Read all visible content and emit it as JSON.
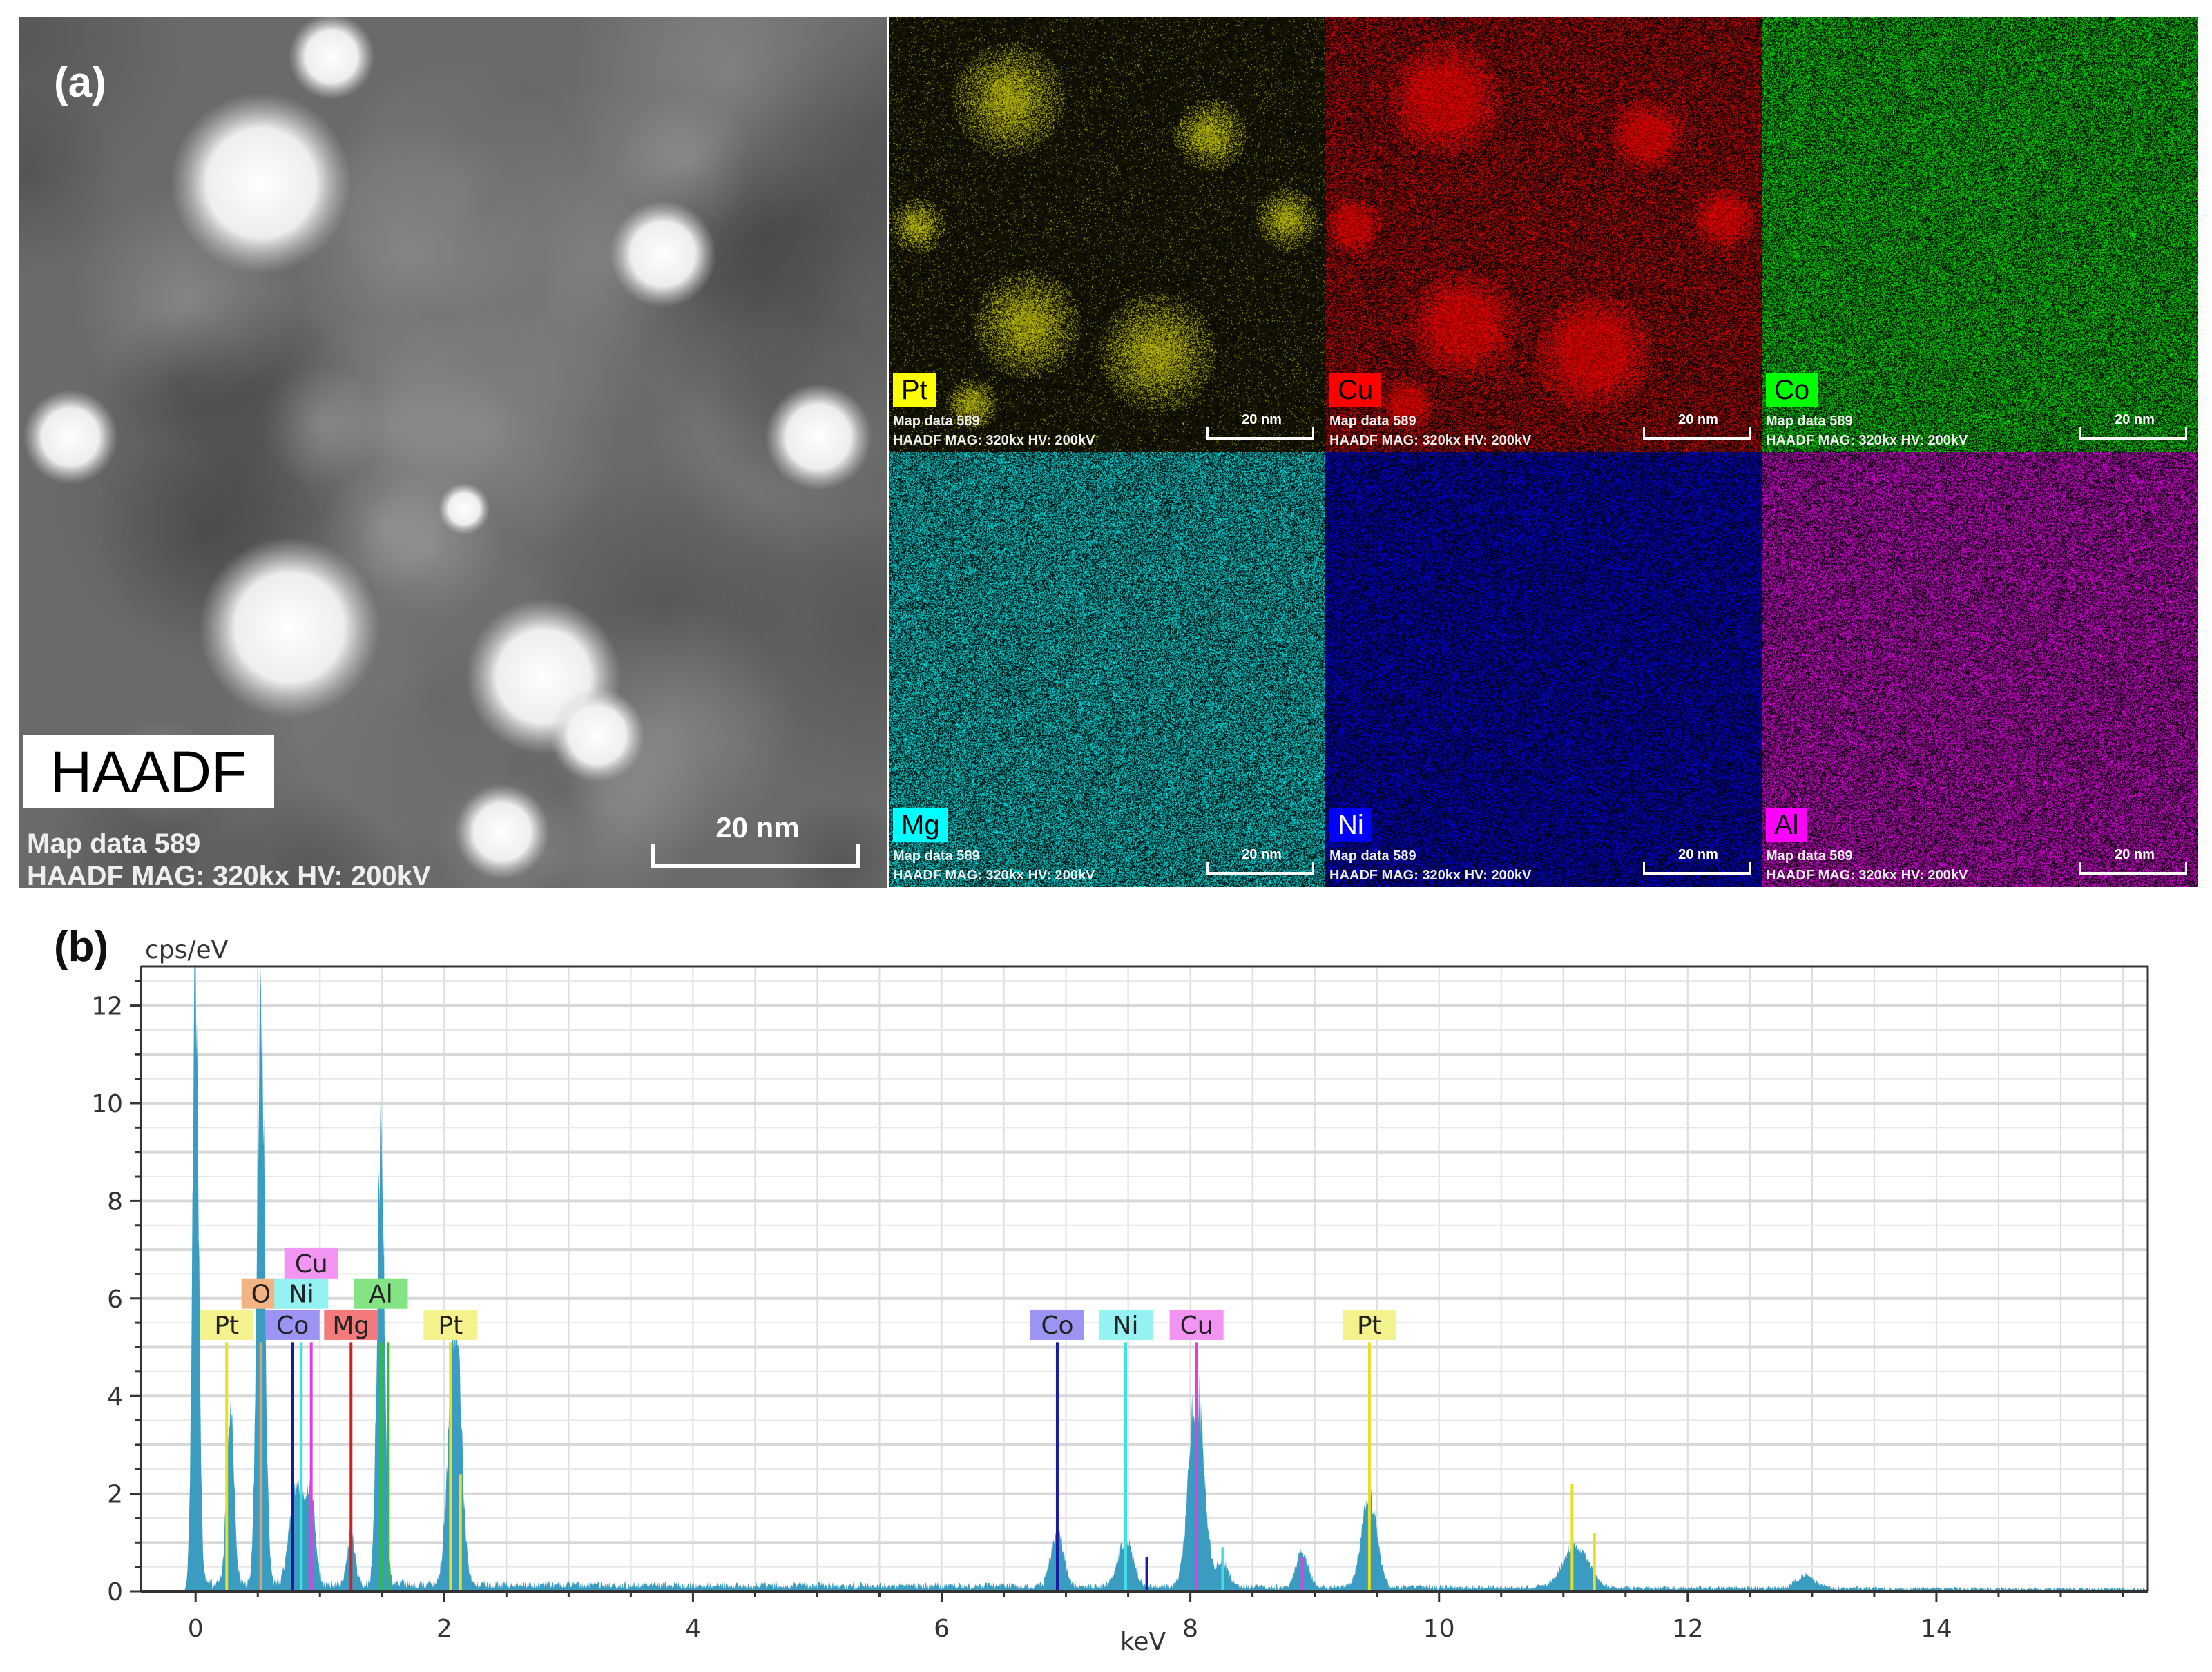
{
  "panel_a": {
    "letter": "(a)",
    "haadf": {
      "title": "HAADF",
      "map_label": "Map data 589",
      "info": "HAADF MAG: 320kx HV: 200kV",
      "scale": "20 nm"
    },
    "maps": [
      {
        "element": "Pt",
        "color": "#ffff00",
        "text_color": "#000000",
        "map_label": "Map data 589",
        "info": "HAADF MAG: 320kx HV: 200kV",
        "scale": "20 nm"
      },
      {
        "element": "Cu",
        "color": "#ff0000",
        "text_color": "#000000",
        "map_label": "Map data 589",
        "info": "HAADF MAG: 320kx HV: 200kV",
        "scale": "20 nm"
      },
      {
        "element": "Co",
        "color": "#00ff00",
        "text_color": "#000000",
        "map_label": "Map data 589",
        "info": "HAADF MAG: 320kx HV: 200kV",
        "scale": "20 nm"
      },
      {
        "element": "Mg",
        "color": "#00ffff",
        "text_color": "#000000",
        "map_label": "Map data 589",
        "info": "HAADF MAG: 320kx HV: 200kV",
        "scale": "20 nm"
      },
      {
        "element": "Ni",
        "color": "#0000ff",
        "text_color": "#ffffff",
        "map_label": "Map data 589",
        "info": "HAADF MAG: 320kx HV: 200kV",
        "scale": "20 nm"
      },
      {
        "element": "Al",
        "color": "#ff00ff",
        "text_color": "#000000",
        "map_label": "Map data 589",
        "info": "HAADF MAG: 320kx HV: 200kV",
        "scale": "20 nm"
      }
    ]
  },
  "panel_b": {
    "letter": "(b)"
  },
  "chart_data": {
    "type": "area",
    "title": "",
    "xlabel": "keV",
    "ylabel": "cps/eV",
    "xlim": [
      -0.44,
      15.7
    ],
    "ylim": [
      0,
      12.8
    ],
    "xticks": [
      0,
      2,
      4,
      6,
      8,
      10,
      12,
      14
    ],
    "yticks": [
      0,
      2,
      4,
      6,
      8,
      10,
      12
    ],
    "grid": true,
    "series_color": "#3a9cc0",
    "background": 0.15,
    "peaks": [
      {
        "energy": 0.0,
        "height": 12.8,
        "width": 0.025
      },
      {
        "energy": 0.28,
        "height": 3.5,
        "width": 0.03
      },
      {
        "energy": 0.525,
        "height": 12.4,
        "width": 0.03
      },
      {
        "energy": 0.78,
        "height": 1.4,
        "width": 0.04
      },
      {
        "energy": 0.85,
        "height": 1.5,
        "width": 0.04
      },
      {
        "energy": 0.93,
        "height": 1.7,
        "width": 0.035
      },
      {
        "energy": 1.25,
        "height": 1.0,
        "width": 0.03
      },
      {
        "energy": 1.49,
        "height": 9.5,
        "width": 0.03
      },
      {
        "energy": 2.07,
        "height": 4.2,
        "width": 0.045
      },
      {
        "energy": 2.12,
        "height": 2.0,
        "width": 0.04
      },
      {
        "energy": 6.93,
        "height": 1.1,
        "width": 0.05
      },
      {
        "energy": 7.48,
        "height": 0.95,
        "width": 0.06
      },
      {
        "energy": 8.05,
        "height": 4.1,
        "width": 0.06
      },
      {
        "energy": 8.26,
        "height": 0.5,
        "width": 0.05
      },
      {
        "energy": 8.9,
        "height": 0.7,
        "width": 0.05
      },
      {
        "energy": 9.44,
        "height": 1.9,
        "width": 0.06
      },
      {
        "energy": 11.1,
        "height": 0.9,
        "width": 0.1
      },
      {
        "energy": 12.95,
        "height": 0.25,
        "width": 0.08
      }
    ],
    "element_markers": [
      {
        "element": "Pt",
        "energy": 0.25,
        "line_color": "#e6e020",
        "label_color": "#f4f28c",
        "row": 0,
        "label": "Pt"
      },
      {
        "element": "O",
        "energy": 0.525,
        "line_color": "#e0a060",
        "label_color": "#f2b482",
        "row": 1,
        "label": "O"
      },
      {
        "element": "Co",
        "energy": 0.78,
        "line_color": "#1a1aa0",
        "label_color": "#9c94f2",
        "row": 0,
        "label": "Co"
      },
      {
        "element": "Ni",
        "energy": 0.85,
        "line_color": "#40e0e0",
        "label_color": "#94f2f2",
        "row": 1,
        "label": "Ni"
      },
      {
        "element": "Cu",
        "energy": 0.93,
        "line_color": "#e040e0",
        "label_color": "#f294f2",
        "row": 2,
        "label": "Cu"
      },
      {
        "element": "Mg",
        "energy": 1.25,
        "line_color": "#d02020",
        "label_color": "#f27a7a",
        "row": 0,
        "label": "Mg"
      },
      {
        "element": "Al",
        "energy": 1.49,
        "line_color": "#30c030",
        "label_color": "#84e484",
        "row": 1,
        "label": "Al"
      },
      {
        "element": "Pt",
        "energy": 2.05,
        "line_color": "#e6e020",
        "label_color": "#f4f28c",
        "row": 0,
        "label": "Pt"
      },
      {
        "element": "Co",
        "energy": 6.93,
        "line_color": "#1a1aa0",
        "label_color": "#9c94f2",
        "row": 0,
        "label": "Co"
      },
      {
        "element": "Ni",
        "energy": 7.48,
        "line_color": "#40e0e0",
        "label_color": "#94f2f2",
        "row": 0,
        "label": "Ni"
      },
      {
        "element": "Cu",
        "energy": 8.05,
        "line_color": "#e040e0",
        "label_color": "#f294f2",
        "row": 0,
        "label": "Cu"
      },
      {
        "element": "Pt",
        "energy": 9.44,
        "line_color": "#e6e020",
        "label_color": "#f4f28c",
        "row": 0,
        "label": "Pt"
      }
    ],
    "minor_markers": [
      {
        "energy": 11.07,
        "height": 2.2,
        "color": "#e6e020"
      },
      {
        "energy": 11.25,
        "height": 1.2,
        "color": "#e6e020"
      },
      {
        "energy": 7.65,
        "height": 0.7,
        "color": "#1a1aa0"
      },
      {
        "energy": 8.26,
        "height": 0.9,
        "color": "#40e0e0"
      },
      {
        "energy": 8.9,
        "height": 0.7,
        "color": "#e040e0"
      },
      {
        "energy": 2.13,
        "height": 2.4,
        "color": "#e6e020"
      },
      {
        "energy": 1.55,
        "height": 5.1,
        "color": "#30c030"
      }
    ]
  }
}
